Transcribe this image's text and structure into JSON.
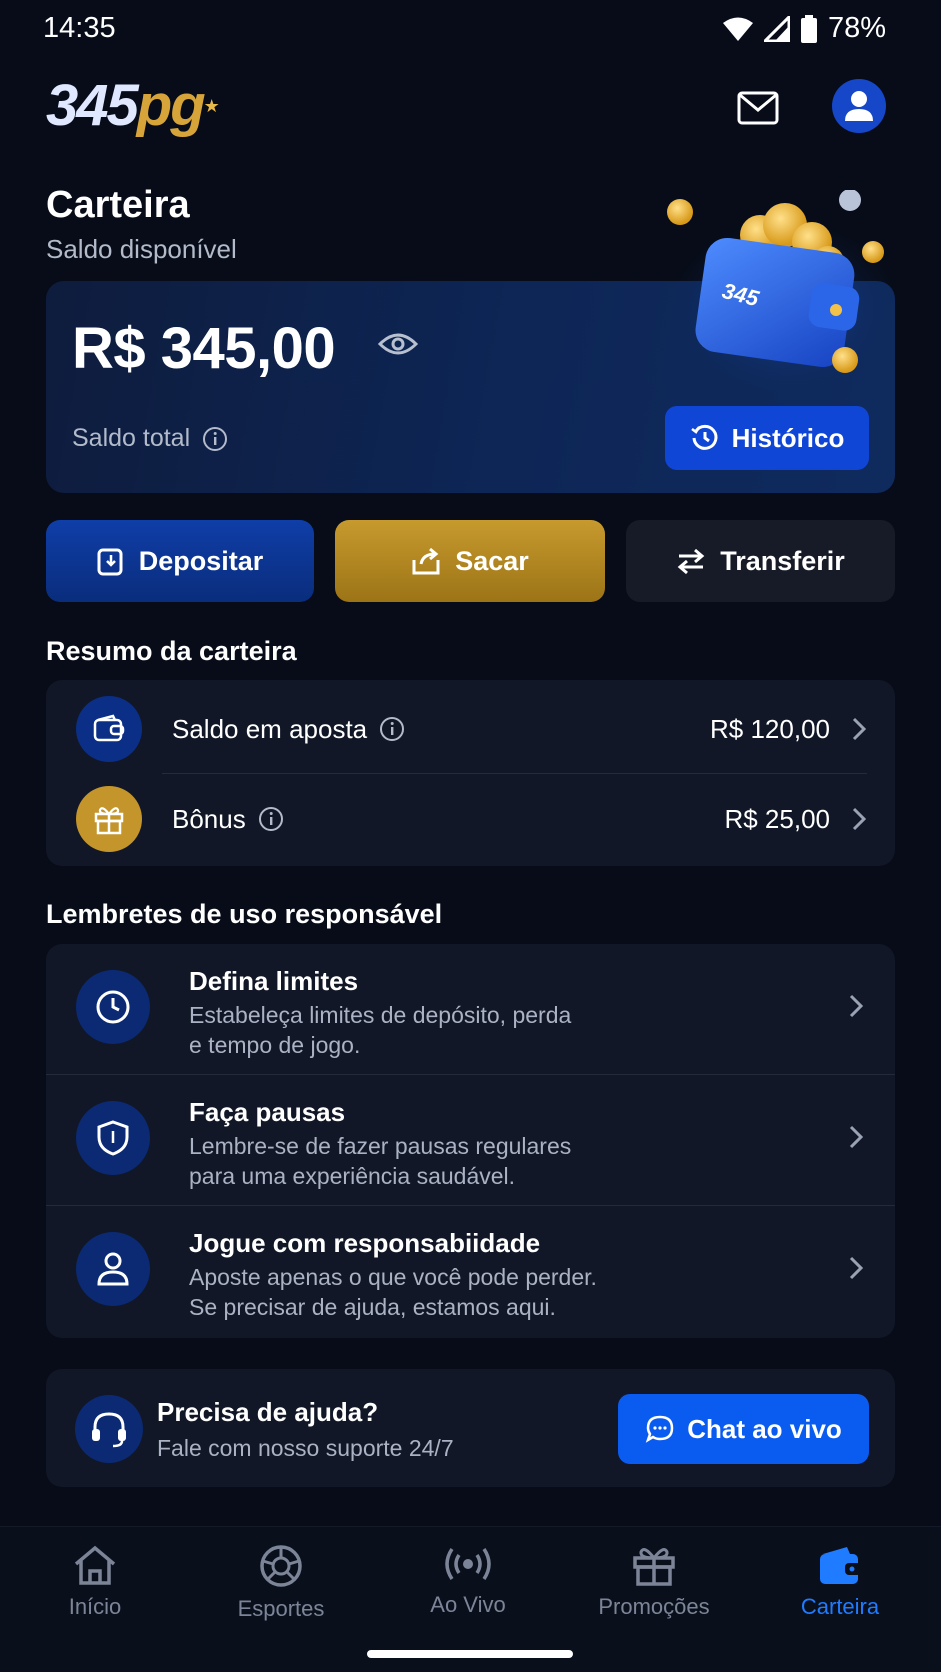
{
  "status_bar": {
    "time": "14:35",
    "battery": "78%"
  },
  "header": {
    "logo_number": "345",
    "logo_suffix": "pg",
    "icons": [
      "mail-icon",
      "user-icon"
    ]
  },
  "wallet": {
    "title": "Carteira",
    "subtitle": "Saldo disponível",
    "balance": "R$ 345,00",
    "total_label": "Saldo total",
    "history_button": "Histórico",
    "art_badge": "345"
  },
  "actions": {
    "deposit": "Depositar",
    "withdraw": "Sacar",
    "transfer": "Transferir"
  },
  "summary": {
    "title": "Resumo da carteira",
    "rows": [
      {
        "label": "Saldo em aposta",
        "value": "R$ 120,00",
        "icon": "wallet-icon",
        "color": "#0b2f86"
      },
      {
        "label": "Bônus",
        "value": "R$ 25,00",
        "icon": "gift-icon",
        "color": "#c3952b"
      }
    ]
  },
  "reminders": {
    "title": "Lembretes de uso responsável",
    "items": [
      {
        "title": "Defina limites",
        "line1": "Estabeleça limites de depósito, perda",
        "line2": "e tempo de jogo.",
        "icon": "clock-icon"
      },
      {
        "title": "Faça pausas",
        "line1": "Lembre-se de fazer pausas regulares",
        "line2": "para uma experiência saudável.",
        "icon": "shield-icon"
      },
      {
        "title": "Jogue com responsabiidade",
        "line1": "Aposte apenas o que você pode perder.",
        "line2": "Se precisar de ajuda, estamos aqui.",
        "icon": "person-icon"
      }
    ]
  },
  "help": {
    "title": "Precisa de ajuda?",
    "subtitle": "Fale com nosso suporte 24/7",
    "chat_button": "Chat ao vivo"
  },
  "bottom_nav": {
    "items": [
      {
        "label": "Início",
        "icon": "home-icon"
      },
      {
        "label": "Esportes",
        "icon": "ball-icon"
      },
      {
        "label": "Ao Vivo",
        "icon": "live-icon"
      },
      {
        "label": "Promoções",
        "icon": "gift-icon"
      },
      {
        "label": "Carteira",
        "icon": "wallet-icon",
        "active": true
      }
    ]
  },
  "colors": {
    "background": "#070c18",
    "primary_blue": "#1046d6",
    "gold": "#c79a2e",
    "active_nav": "#1f7bff"
  }
}
